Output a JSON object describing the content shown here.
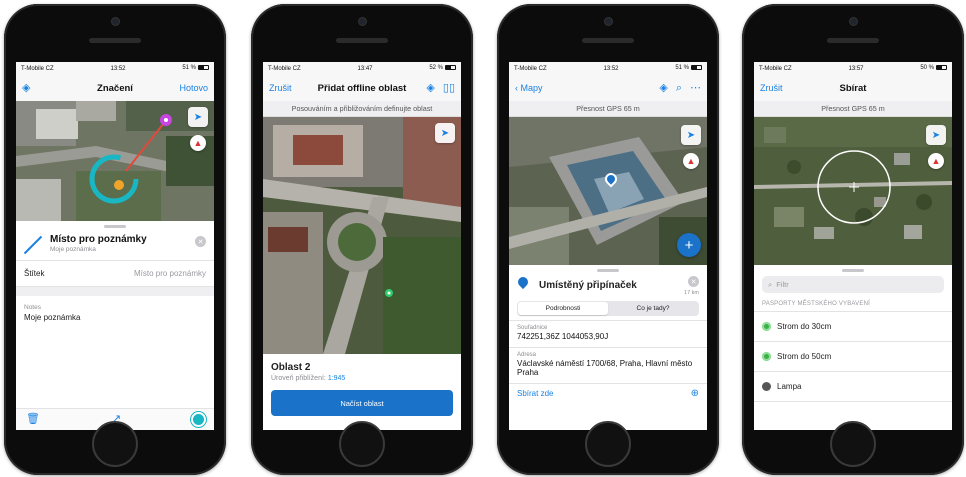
{
  "phones": [
    {
      "status": {
        "carrier": "T-Mobile CZ",
        "time": "13:52",
        "battery": "51 %"
      },
      "nav": {
        "title": "Značení",
        "right": "Hotovo"
      },
      "sheet": {
        "title": "Místo pro poznámky",
        "subtitle": "Moje poznámka",
        "label_key": "Štítek",
        "label_placeholder": "Místo pro poznámky",
        "notes_key": "Notes",
        "notes_value": "Moje poznámka"
      },
      "icons": {
        "trash": "trash-icon",
        "arrow": "arrow-icon",
        "color": "color-icon"
      }
    },
    {
      "status": {
        "carrier": "T-Mobile CZ",
        "time": "13:47",
        "battery": "52 %"
      },
      "nav": {
        "left": "Zrušit",
        "title": "Přidat offline oblast"
      },
      "subbar": "Posouváním a přibližováním definujte oblast",
      "card": {
        "title": "Oblast 2",
        "zoom_label": "Úroveň přiblížení:",
        "zoom_value": "1:945",
        "button": "Načíst oblast"
      }
    },
    {
      "status": {
        "carrier": "T-Mobile CZ",
        "time": "13:52",
        "battery": "51 %"
      },
      "nav": {
        "left": "Mapy"
      },
      "subbar": "Přesnost GPS 65 m",
      "sheet": {
        "title": "Umístěný připínaček",
        "distance": "17 km",
        "seg_left": "Podrobnosti",
        "seg_right": "Co je tady?",
        "coord_key": "Souřadnice",
        "coord_value": "742251,36Z 1044053,90J",
        "addr_key": "Adresa",
        "addr_value": "Václavské náměstí 1700/68, Praha, Hlavní město Praha",
        "collect": "Sbírat zde"
      }
    },
    {
      "status": {
        "carrier": "T-Mobile CZ",
        "time": "13:57",
        "battery": "50 %"
      },
      "nav": {
        "left": "Zrušit",
        "title": "Sbírat"
      },
      "subbar": "Přesnost GPS 65 m",
      "sheet": {
        "search_placeholder": "Filtr",
        "section": "PASPORTY MĚSTSKÉHO VYBAVENÍ",
        "items": [
          {
            "label": "Strom do 30cm",
            "color": "#3fae49"
          },
          {
            "label": "Strom do 50cm",
            "color": "#3fae49"
          },
          {
            "label": "Lampa",
            "color": "#555555"
          }
        ]
      }
    }
  ],
  "colors": {
    "accent": "#1a82e2",
    "button": "#1a73c8",
    "markup": "#19b6c3"
  }
}
